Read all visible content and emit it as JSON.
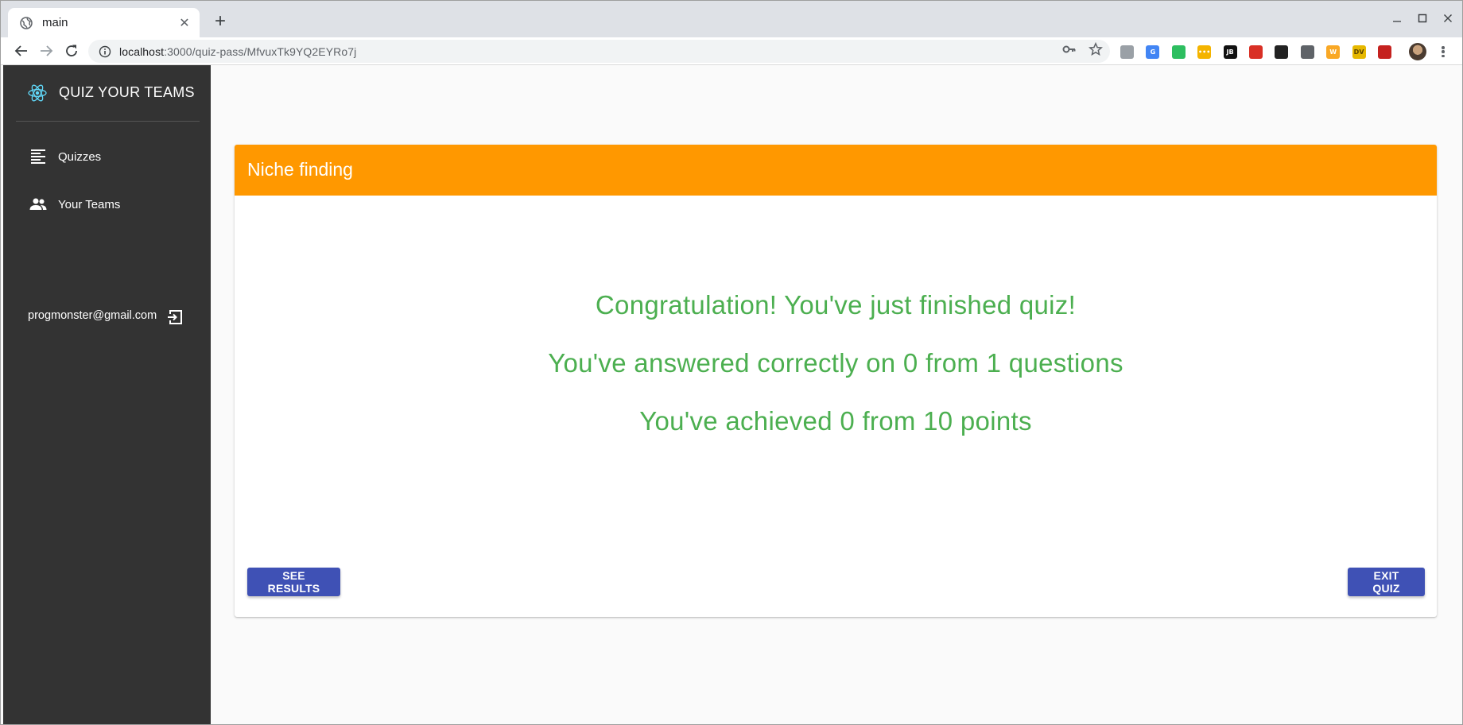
{
  "browser": {
    "tab_title": "main",
    "new_tab_label": "+",
    "url_host": "localhost",
    "url_rest": ":3000/quiz-pass/MfvuxTk9YQ2EYRo7j",
    "icons": [
      "globe-icon",
      "back-icon",
      "forward-icon",
      "reload-icon",
      "info-icon",
      "key-icon",
      "star-icon"
    ],
    "extensions": [
      {
        "name": "globe-extension-icon",
        "text": "",
        "color": "#9aa0a6"
      },
      {
        "name": "translate-extension-icon",
        "text": "G",
        "color": "#4285f4"
      },
      {
        "name": "evernote-extension-icon",
        "text": "",
        "color": "#2dbe60"
      },
      {
        "name": "notes-extension-icon",
        "text": "•••",
        "color": "#f4b400"
      },
      {
        "name": "jb-extension-icon",
        "text": "JB",
        "color": "#111111"
      },
      {
        "name": "red-extension-icon",
        "text": "",
        "color": "#d93025"
      },
      {
        "name": "gnome-extension-icon",
        "text": "",
        "color": "#222222"
      },
      {
        "name": "laptop-extension-icon",
        "text": "",
        "color": "#5f6368"
      },
      {
        "name": "w-extension-icon",
        "text": "W",
        "color": "#f9a825"
      },
      {
        "name": "dv-extension-icon",
        "text": "DV",
        "color": "#e6b800"
      },
      {
        "name": "pdf-extension-icon",
        "text": "",
        "color": "#c5221f"
      }
    ]
  },
  "sidebar": {
    "brand": "QUIZ YOUR TEAMS",
    "items": [
      {
        "label": "Quizzes",
        "icon": "list-icon"
      },
      {
        "label": "Your Teams",
        "icon": "people-icon"
      }
    ],
    "user_email": "progmonster@gmail.com",
    "logout_icon": "logout-icon"
  },
  "quiz": {
    "title": "Niche finding",
    "header_color": "#ff9800",
    "message_color": "#4caf50",
    "messages": {
      "congrats": "Congratulation! You've just finished quiz!",
      "answered": "You've answered correctly on 0 from 1 questions",
      "points": "You've achieved 0 from 10 points"
    },
    "see_results_label": "SEE RESULTS",
    "exit_label": "EXIT QUIZ",
    "button_color": "#3f51b5"
  }
}
